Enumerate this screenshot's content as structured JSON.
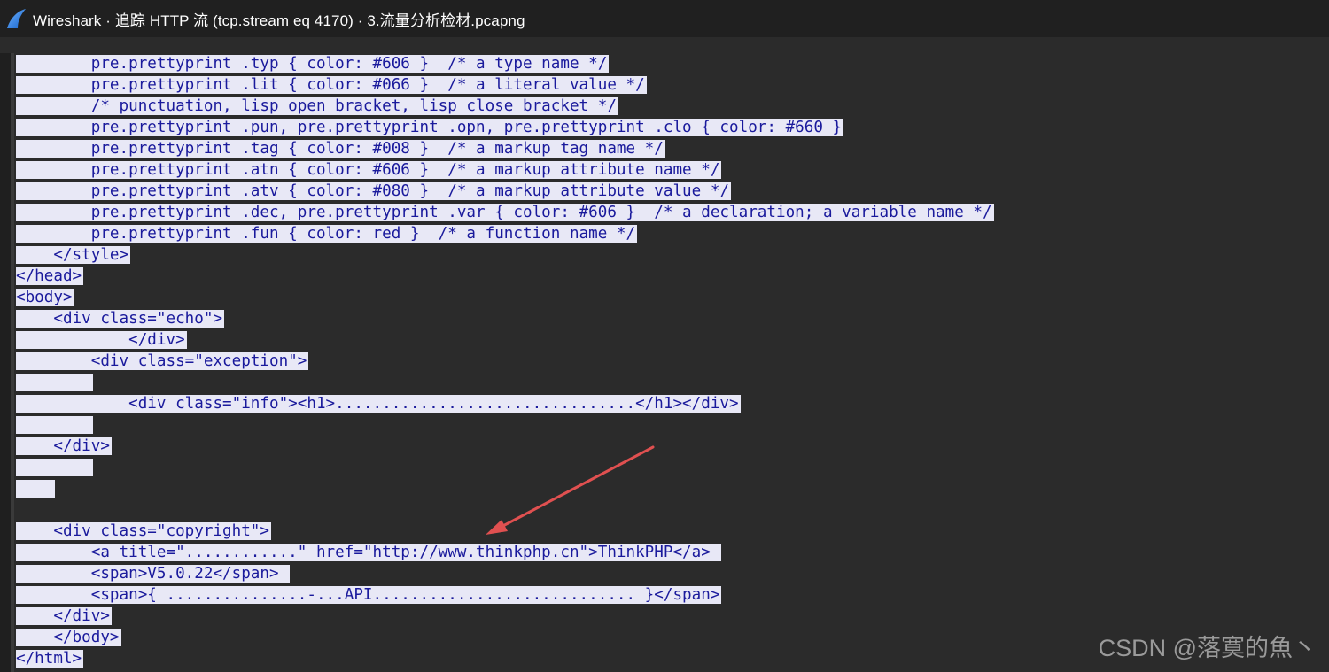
{
  "window": {
    "title": "Wireshark · 追踪 HTTP 流 (tcp.stream eq 4170) · 3.流量分析检材.pcapng",
    "icon": "wireshark-fin-icon"
  },
  "stream_lines": [
    "        pre.prettyprint .typ { color: #606 }  /* a type name */",
    "        pre.prettyprint .lit { color: #066 }  /* a literal value */",
    "        /* punctuation, lisp open bracket, lisp close bracket */",
    "        pre.prettyprint .pun, pre.prettyprint .opn, pre.prettyprint .clo { color: #660 }",
    "        pre.prettyprint .tag { color: #008 }  /* a markup tag name */",
    "        pre.prettyprint .atn { color: #606 }  /* a markup attribute name */",
    "        pre.prettyprint .atv { color: #080 }  /* a markup attribute value */",
    "        pre.prettyprint .dec, pre.prettyprint .var { color: #606 }  /* a declaration; a variable name */",
    "        pre.prettyprint .fun { color: red }  /* a function name */",
    "    </style>",
    "</head>",
    "<body>",
    "    <div class=\"echo\">",
    "            </div>",
    "        <div class=\"exception\">",
    "        ",
    "            <div class=\"info\"><h1>................................</h1></div>",
    "        ",
    "    </div>",
    "        ",
    "    ",
    "    <div class=\"copyright\">",
    "        <a title=\"............\" href=\"http://www.thinkphp.cn\">ThinkPHP</a> ",
    "        <span>V5.0.22</span> ",
    "        <span>{ ...............-...API............................ }</span>",
    "    </div>",
    "    </body>",
    "</html>"
  ],
  "watermark": "CSDN @落寞的魚丶",
  "colors": {
    "text": "#1a1a9c",
    "selection": "#e8e8f6",
    "background": "#2b2b2b",
    "annotation_arrow": "#e05050"
  }
}
